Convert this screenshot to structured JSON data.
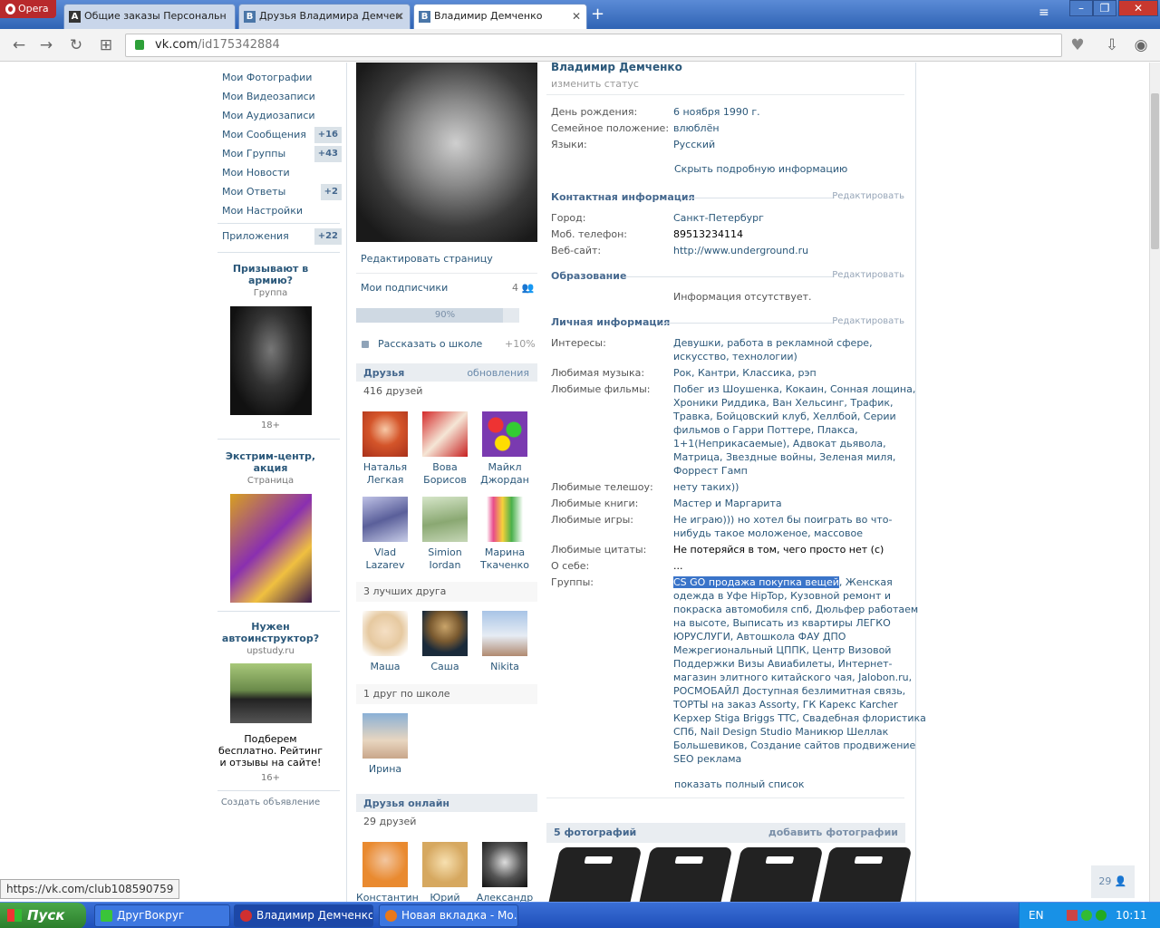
{
  "browser": {
    "app_label": "Opera",
    "tabs": [
      {
        "title": "Общие заказы Персональн",
        "icon": "A"
      },
      {
        "title": "Друзья Владимира Демчен",
        "icon": "B"
      },
      {
        "title": "Владимир Демченко",
        "icon": "B"
      }
    ],
    "url_host": "vk.com",
    "url_path": "/id175342884"
  },
  "sidebar": {
    "items": [
      {
        "label": "Мои Фотографии",
        "count": ""
      },
      {
        "label": "Мои Видеозаписи",
        "count": ""
      },
      {
        "label": "Мои Аудиозаписи",
        "count": ""
      },
      {
        "label": "Мои Сообщения",
        "count": "+16"
      },
      {
        "label": "Мои Группы",
        "count": "+43"
      },
      {
        "label": "Мои Новости",
        "count": ""
      },
      {
        "label": "Мои Ответы",
        "count": "+2"
      },
      {
        "label": "Мои Настройки",
        "count": ""
      }
    ],
    "apps": {
      "label": "Приложения",
      "count": "+22"
    },
    "ads": [
      {
        "title": "Призывают в армию?",
        "sub": "Группа",
        "age": "18+"
      },
      {
        "title": "Экстрим-центр, акция",
        "sub": "Страница"
      },
      {
        "title": "Нужен автоинструктор?",
        "sub": "upstudy.ru",
        "text": "Подберем бесплатно. Рейтинг и отзывы на сайте!",
        "age": "16+"
      }
    ],
    "create_ad": "Создать объявление"
  },
  "middle": {
    "edit_page": "Редактировать страницу",
    "subscribers": "Мои подписчики",
    "subscribers_count": "4",
    "progress_label": "90%",
    "progress_value": 0.9,
    "school_link": "Рассказать о школе",
    "school_plus": "+10%",
    "friends_title": "Друзья",
    "friends_updates": "обновления",
    "friends_count": "416 друзей",
    "friends": [
      {
        "first": "Наталья",
        "last": "Легкая"
      },
      {
        "first": "Вова",
        "last": "Борисов"
      },
      {
        "first": "Майкл",
        "last": "Джордан"
      },
      {
        "first": "Vlad",
        "last": "Lazarev"
      },
      {
        "first": "Simion",
        "last": "Iordan"
      },
      {
        "first": "Марина",
        "last": "Ткаченко"
      }
    ],
    "best_title": "3 лучших друга",
    "best": [
      {
        "name": "Маша"
      },
      {
        "name": "Саша"
      },
      {
        "name": "Nikita"
      }
    ],
    "school_title": "1 друг по школе",
    "school_friend": "Ирина",
    "online_title": "Друзья онлайн",
    "online_count": "29 друзей",
    "online": [
      {
        "name": "Константин"
      },
      {
        "name": "Юрий"
      },
      {
        "name": "Александр"
      }
    ]
  },
  "profile": {
    "name": "Владимир Демченко",
    "status": "изменить статус",
    "birthday_label": "День рождения:",
    "birthday": "6 ноября 1990 г.",
    "family_label": "Семейное положение:",
    "family": "влюблён",
    "lang_label": "Языки:",
    "lang": "Русский",
    "hide_info": "Скрыть подробную информацию",
    "contact_title": "Контактная информация",
    "edit": "Редактировать",
    "city_label": "Город:",
    "city": "Санкт-Петербург",
    "phone_label": "Моб. телефон:",
    "phone": "89513234114",
    "site_label": "Веб-сайт:",
    "site": "http://www.underground.ru",
    "edu_title": "Образование",
    "edu_none": "Информация отсутствует.",
    "personal_title": "Личная информация",
    "interests_label": "Интересы:",
    "interests_1": "Девушки, работа в рекламной сфере,",
    "interests_2": "искусство, технологии)",
    "music_label": "Любимая музыка:",
    "music": "Рок, Кантри, Классика, рэп",
    "films_label": "Любимые фильмы:",
    "films": [
      "Побег из Шоушенка, Кокаин, Сонная лощина,",
      "Хроники Риддика, Ван Хельсинг, Трафик,",
      "Травка, Бойцовский клуб, Хеллбой, Серии",
      "фильмов о Гарри Поттере, Плакса,",
      "1+1(Неприкасаемые), Адвокат дьявола,",
      "Матрица, Звездные войны, Зеленая миля,",
      "Форрест Гамп"
    ],
    "tv_label": "Любимые телешоу:",
    "tv": "нету таких))",
    "books_label": "Любимые книги:",
    "books": "Мастер и Маргарита",
    "games_label": "Любимые игры:",
    "games_1": "Не играю))) но хотел бы поиграть во что-",
    "games_2": "нибудь такое моложеное, массовое",
    "quotes_label": "Любимые цитаты:",
    "quotes": "Не потеряйся в том, чего просто нет (с)",
    "about_label": "О себе:",
    "about": "...",
    "groups_label": "Группы:",
    "groups_first": "CS GO продажа покупка вещей",
    "groups": [
      ", Женская",
      "одежда в Уфе HipTop, Кузовной ремонт и",
      "покраска автомобиля спб, Дюльфер работаем",
      "на высоте, Выписать из квартиры ЛЕГКО",
      "ЮРУСЛУГИ, Автошкола ФАУ ДПО",
      "Межрегиональный ЦППК, Центр Визовой",
      "Поддержки Визы Авиабилеты, Интернет-",
      "магазин элитного китайского чая, Jalobon.ru,",
      "РОСМОБАЙЛ Доступная безлимитная связь,",
      "ТОРТЫ на заказ Assorty, ГК Карекс Karcher",
      "Керхер Stiga Briggs TTC, Свадебная флористика",
      "СПб, Nail Design Studio Маникюр Шеллак",
      "Большевиков, Создание сайтов продвижение",
      "SEO реклама"
    ],
    "show_full": "показать полный список",
    "photos_title": "5 фотографий",
    "add_photos": "добавить фотографии"
  },
  "status_url": "https://vk.com/club108590759",
  "counter": "29",
  "taskbar": {
    "start": "Пуск",
    "tasks": [
      "ДругВокруг",
      "Владимир Демченко...",
      "Новая вкладка - Мо..."
    ],
    "lang": "EN",
    "time": "10:11"
  }
}
